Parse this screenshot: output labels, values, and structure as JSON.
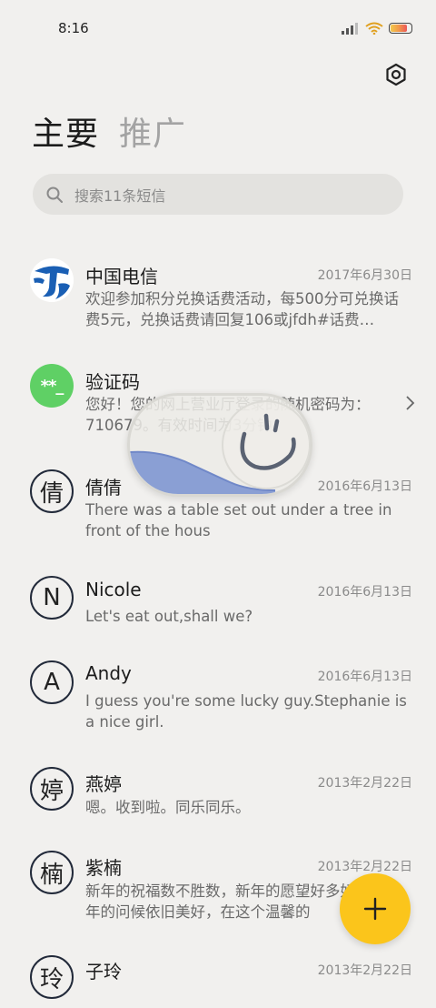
{
  "status_bar": {
    "time": "8:16",
    "signal_icon": "signal-icon",
    "wifi_icon": "wifi-icon",
    "battery_icon": "battery-icon",
    "battery_level": 0.85
  },
  "header": {
    "settings_icon": "settings-icon",
    "tabs": [
      {
        "label": "主要",
        "active": true
      },
      {
        "label": "推广",
        "active": false
      }
    ]
  },
  "search": {
    "placeholder": "搜索11条短信",
    "icon": "search-icon"
  },
  "conversations": [
    {
      "name": "中国电信",
      "date": "2017年6月30日",
      "preview": "欢迎参加积分兑换话费活动，每500分可兑换话费5元，兑换话费请回复106或jfdh#话费…",
      "avatar_type": "logo",
      "avatar_icon": "china-telecom-logo"
    },
    {
      "name": "验证码",
      "date": "",
      "preview": "您好！您的网上营业厅登录的随机密码为：710679。有效时间为3分钟",
      "avatar_type": "code",
      "avatar_text": "**_"
    },
    {
      "name": "倩倩",
      "date": "2016年6月13日",
      "preview": "There was a table set out under a tree in front of the hous",
      "avatar_type": "letter",
      "avatar_text": "倩"
    },
    {
      "name": "Nicole",
      "date": "2016年6月13日",
      "preview": "Let's eat out,shall we?",
      "avatar_type": "letter",
      "avatar_text": "N"
    },
    {
      "name": "Andy",
      "date": "2016年6月13日",
      "preview": "I guess you're some lucky guy.Stephanie is a nice girl.",
      "avatar_type": "letter",
      "avatar_text": "A"
    },
    {
      "name": "燕婷",
      "date": "2013年2月22日",
      "preview": "嗯。收到啦。同乐同乐。",
      "avatar_type": "letter",
      "avatar_text": "婷"
    },
    {
      "name": "紫楠",
      "date": "2013年2月22日",
      "preview": "新年的祝福数不胜数，新年的愿望好多好多，新年的问候依旧美好，在这个温馨的",
      "avatar_type": "letter",
      "avatar_text": "楠"
    },
    {
      "name": "子玲",
      "date": "2013年2月22日",
      "preview": "",
      "avatar_type": "letter",
      "avatar_text": "玲"
    }
  ],
  "overlay": {
    "icon": "loading-smile-icon"
  },
  "fab": {
    "icon": "plus-icon"
  }
}
